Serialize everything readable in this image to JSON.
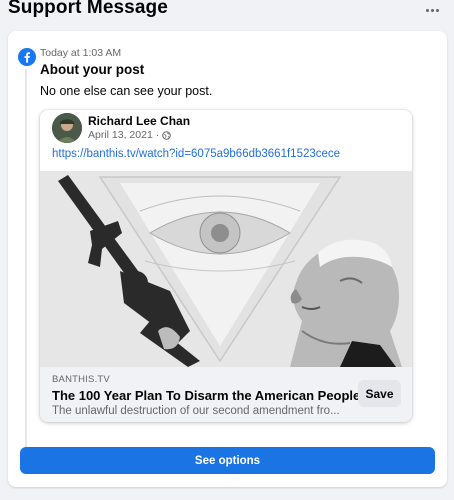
{
  "header": {
    "title": "Support Message",
    "more_icon": "more-horizontal-icon"
  },
  "message": {
    "app_icon": "facebook-icon",
    "timestamp": "Today at 1:03 AM",
    "title": "About your post",
    "body": "No one else can see your post."
  },
  "post": {
    "author": "Richard Lee Chan",
    "date": "April 13, 2021 ·",
    "privacy_icon": "globe-icon",
    "link": "https://banthis.tv/watch?id=6075a9b66db3661f1523cece",
    "preview": {
      "domain": "BANTHIS.TV",
      "title": "The 100 Year Plan To Disarm the American People",
      "description": "The unlawful destruction of our second amendment fro...",
      "save_label": "Save"
    }
  },
  "actions": {
    "see_options_label": "See options"
  },
  "colors": {
    "accent": "#1b74e4",
    "link": "#216fdb",
    "background": "#f0f2f5",
    "secondary_text": "#65676b"
  }
}
